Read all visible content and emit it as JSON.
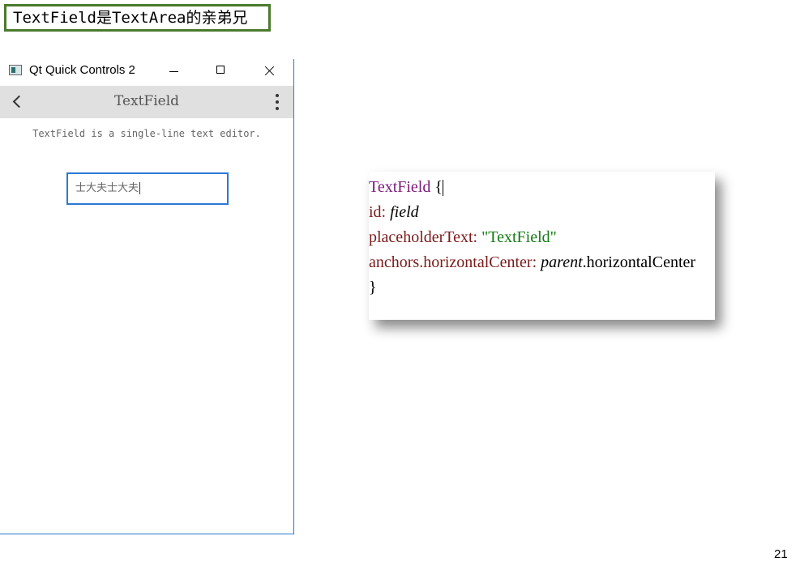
{
  "slide": {
    "title": "TextField是TextArea的亲弟兄",
    "page_number": "21"
  },
  "window": {
    "title": "Qt Quick Controls 2",
    "icon": "qt-app-icon",
    "controls": [
      "minimize-icon",
      "maximize-icon",
      "close-icon"
    ]
  },
  "toolbar": {
    "back_icon": "chevron-left-icon",
    "title": "TextField",
    "menu_icon": "more-vertical-icon"
  },
  "content": {
    "description": "TextField is a single-line text editor.",
    "text_field_value": "士大夫士大夫"
  },
  "code": {
    "type_name": "TextField",
    "open_brace": "{",
    "id_key": "id:",
    "id_value": "field",
    "placeholder_key": "placeholderText:",
    "placeholder_value": "\"TextField\"",
    "anchors_key": "anchors.horizontalCenter:",
    "anchors_value_obj": "parent",
    "anchors_value_prop": ".horizontalCenter",
    "close_brace": "}"
  },
  "colors": {
    "title_border": "#4a7a2c",
    "window_border": "#2b78d4",
    "toolbar_bg": "#e0e0e0",
    "keyword": "#7a1a7a",
    "property": "#7a1a1a",
    "string": "#157a15"
  }
}
